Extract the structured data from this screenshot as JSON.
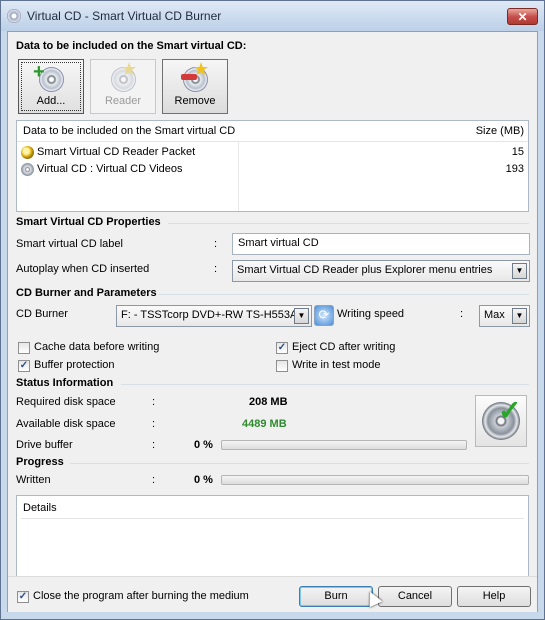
{
  "window": {
    "title": "Virtual CD - Smart Virtual CD Burner",
    "close_label": "✕"
  },
  "data_section": {
    "heading": "Data to be included on the Smart virtual CD:",
    "buttons": {
      "add": "Add...",
      "reader": "Reader",
      "remove": "Remove"
    },
    "list": {
      "col_name": "Data to be included on the Smart virtual CD",
      "col_size": "Size (MB)",
      "rows": [
        {
          "name": "Smart Virtual CD Reader Packet",
          "size": "15"
        },
        {
          "name": "Virtual CD : Virtual CD Videos",
          "size": "193"
        }
      ]
    }
  },
  "properties": {
    "heading": "Smart Virtual CD Properties",
    "label_label": "Smart virtual CD label",
    "label_value": "Smart virtual CD",
    "autoplay_label": "Autoplay when CD inserted",
    "autoplay_value": "Smart Virtual CD Reader plus Explorer menu entries",
    "colon": ":"
  },
  "burner": {
    "heading": "CD Burner and Parameters",
    "burner_label": "CD Burner",
    "burner_value": "F: - TSSTcorp DVD+-RW TS-H553A",
    "speed_label": "Writing speed",
    "speed_value": "Max",
    "options": {
      "cache": "Cache data before writing",
      "eject": "Eject CD after writing",
      "buffer": "Buffer protection",
      "test": "Write in test mode"
    }
  },
  "status": {
    "heading": "Status Information",
    "required_label": "Required disk space",
    "required_value": "208 MB",
    "available_label": "Available disk space",
    "available_value": "4489 MB",
    "buffer_label": "Drive buffer",
    "buffer_value": "0 %",
    "buffer_fraction": 0
  },
  "progress": {
    "heading": "Progress",
    "written_label": "Written",
    "written_value": "0 %",
    "written_fraction": 0
  },
  "details": {
    "title": "Details"
  },
  "footer": {
    "close_after": "Close the program after burning the medium",
    "burn": "Burn",
    "cancel": "Cancel",
    "help": "Help"
  },
  "colors": {
    "available_value": "#2e8b2e",
    "accent": "#3c7fb1"
  }
}
